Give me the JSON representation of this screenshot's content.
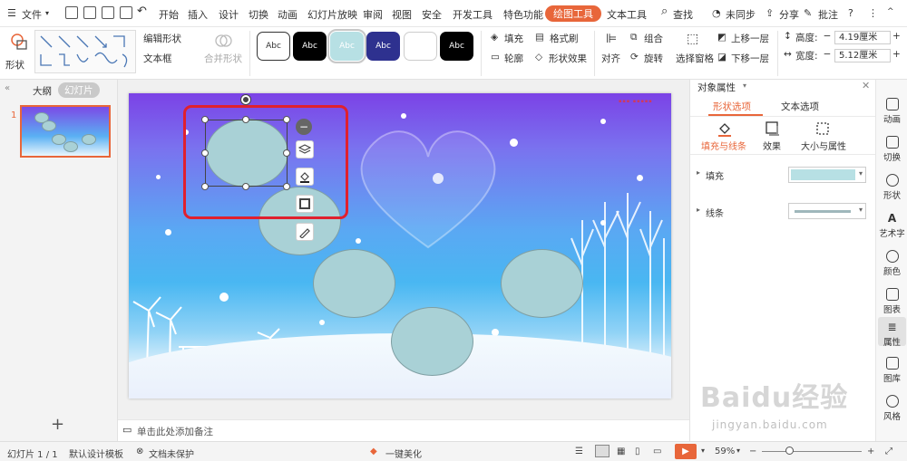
{
  "menu": {
    "file": "文件",
    "tabs": [
      "开始",
      "插入",
      "设计",
      "切换",
      "动画",
      "幻灯片放映",
      "审阅",
      "视图",
      "安全",
      "开发工具",
      "特色功能",
      "绘图工具",
      "文本工具"
    ],
    "active_tab": "绘图工具",
    "search": "查找",
    "sync": "未同步",
    "share": "分享",
    "comment": "批注"
  },
  "ribbon": {
    "shape": "形状",
    "edit_shape": "编辑形状",
    "textbox": "文本框",
    "merge_shape": "合并形状",
    "style_samples": [
      "Abc",
      "Abc",
      "Abc",
      "Abc",
      "",
      "Abc"
    ],
    "fill": "填充",
    "format_brush": "格式刷",
    "outline": "轮廓",
    "shape_effect": "形状效果",
    "align": "对齐",
    "group": "组合",
    "rotate": "旋转",
    "selection_pane": "选择窗格",
    "bring_forward": "上移一层",
    "send_backward": "下移一层",
    "height_label": "高度:",
    "height_value": "4.19厘米",
    "width_label": "宽度:",
    "width_value": "5.12厘米",
    "minus": "−",
    "plus": "+"
  },
  "left": {
    "outline_tab": "大纲",
    "slides_tab": "幻灯片",
    "slide_number": "1"
  },
  "notes": {
    "placeholder": "单击此处添加备注"
  },
  "props": {
    "title": "对象属性",
    "tab_shape": "形状选项",
    "tab_text": "文本选项",
    "sub_fill_line": "填充与线条",
    "sub_effect": "效果",
    "sub_size": "大小与属性",
    "fill_label": "填充",
    "line_label": "线条",
    "fill_color": "#b7e0e4",
    "line_color": "#9fb7bb"
  },
  "sidebar": [
    "动画",
    "切换",
    "形状",
    "艺术字",
    "颜色",
    "图表",
    "属性",
    "图库",
    "风格"
  ],
  "status": {
    "slide": "幻灯片 1 / 1",
    "template": "默认设计模板",
    "protect": "文档未保护",
    "beautify": "一键美化",
    "zoom": "59%",
    "zoom_level": 0.59
  },
  "watermark": {
    "brand": "Baidu经验",
    "url": "jingyan.baidu.com"
  },
  "colors": {
    "accent": "#e8663a",
    "selection": "#e0202e",
    "shape_fill": "#a9d1d6"
  }
}
